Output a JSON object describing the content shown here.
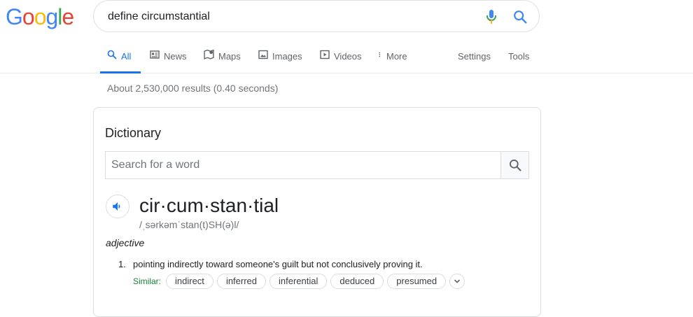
{
  "logo": {
    "letters": [
      "G",
      "o",
      "o",
      "g",
      "l",
      "e"
    ],
    "colors": [
      "#4285f4",
      "#ea4335",
      "#fbbc05",
      "#4285f4",
      "#34a853",
      "#ea4335"
    ]
  },
  "search": {
    "query": "define circumstantial"
  },
  "tabs": [
    {
      "label": "All",
      "icon": "search-icon"
    },
    {
      "label": "News",
      "icon": "news-icon"
    },
    {
      "label": "Maps",
      "icon": "map-icon"
    },
    {
      "label": "Images",
      "icon": "image-icon"
    },
    {
      "label": "Videos",
      "icon": "video-icon"
    },
    {
      "label": "More",
      "icon": "more-vertical-icon"
    }
  ],
  "tools": {
    "settings": "Settings",
    "tools": "Tools"
  },
  "stats": "About 2,530,000 results (0.40 seconds)",
  "dictionary": {
    "title": "Dictionary",
    "search_placeholder": "Search for a word",
    "headword": "cir·cum·stan·tial",
    "phonetic": "/ˌsərkəmˈstan(t)SH(ə)l/",
    "part_of_speech": "adjective",
    "definitions": [
      {
        "number": "1.",
        "text": "pointing indirectly toward someone's guilt but not conclusively proving it.",
        "similar_label": "Similar:",
        "similar": [
          "indirect",
          "inferred",
          "inferential",
          "deduced",
          "presumed"
        ]
      }
    ]
  },
  "colors": {
    "accent": "#1a73e8",
    "similar_green": "#188038"
  }
}
